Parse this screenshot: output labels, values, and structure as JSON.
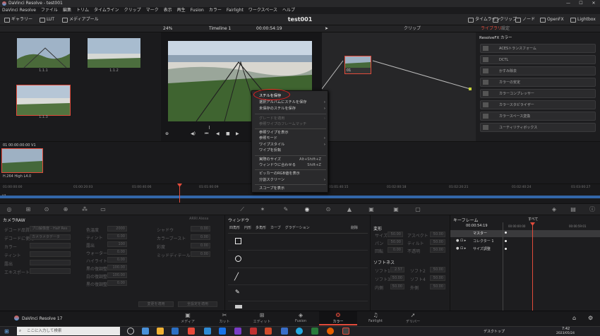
{
  "window": {
    "title": "DaVinci Resolve - test001",
    "min": "—",
    "max": "☐",
    "close": "✕"
  },
  "menu": [
    "DaVinci Resolve",
    "ファイル",
    "編集",
    "トリム",
    "タイムライン",
    "クリップ",
    "マーク",
    "表示",
    "再生",
    "Fusion",
    "カラー",
    "Fairlight",
    "ワークスペース",
    "ヘルプ"
  ],
  "toolbar": {
    "gallery": "ギャラリー",
    "lut": "LUT",
    "mediapool": "メディアプール",
    "project_title": "test001",
    "timeline": "タイムライン",
    "clip": "クリップ",
    "node": "ノード",
    "openfx": "OpenFX",
    "lightbox": "Lightbox"
  },
  "subtool": {
    "zoom": "24%",
    "timeline_name": "Timeline 1",
    "timecode": "00:00:54:19",
    "clip": "クリップ",
    "library": "ライブラリ",
    "settings": "設定"
  },
  "gallery": {
    "stills": [
      {
        "label": "1.1.1"
      },
      {
        "label": "1.1.2"
      },
      {
        "label": "1.1.3"
      }
    ]
  },
  "nodes": {
    "node_label": "01"
  },
  "library": {
    "title": "ResolveFX カラー",
    "items": [
      "ACESトランスフォーム",
      "DCTL",
      "かすみ除去",
      "カラーの安定",
      "カラーコンプレッサー",
      "カラースタビライザー",
      "カラースペース変換",
      "ユーティリティボックス"
    ]
  },
  "clips": {
    "header": "01  00:00:00:00  V1",
    "clip_name": "H.264 High L4.0"
  },
  "ruler": {
    "track": "V1",
    "ticks": [
      "01:00:00:00",
      "01:00:20:03",
      "01:00:40:06",
      "01:01:00:09",
      "01:01:20:12",
      "01:01:40:15",
      "01:02:00:18",
      "01:02:20:21",
      "01:02:40:24",
      "01:03:00:27"
    ]
  },
  "context_menu": {
    "items": [
      {
        "label": "スチルを保存",
        "shortcut": "",
        "arrow": false,
        "disabled": false
      },
      {
        "label": "選択アルバムにスチルを保存",
        "shortcut": "",
        "arrow": true,
        "disabled": false
      },
      {
        "label": "未保存のスチルを保存",
        "shortcut": "",
        "arrow": true,
        "disabled": false
      },
      {
        "label": "グレードを適用",
        "shortcut": "",
        "arrow": true,
        "disabled": true
      },
      {
        "label": "参照ワイプのフレームマッチ",
        "shortcut": "",
        "arrow": false,
        "disabled": true
      },
      {
        "label": "参照ワイプを表示",
        "shortcut": "",
        "arrow": false,
        "disabled": false
      },
      {
        "label": "参照モード",
        "shortcut": "",
        "arrow": true,
        "disabled": false
      },
      {
        "label": "ワイプスタイル",
        "shortcut": "",
        "arrow": true,
        "disabled": false
      },
      {
        "label": "ワイプを反転",
        "shortcut": "",
        "arrow": false,
        "disabled": false
      },
      {
        "label": "実際のサイズ",
        "shortcut": "Alt+Shift+Z",
        "arrow": false,
        "disabled": false
      },
      {
        "label": "ウィンドウに合わせる",
        "shortcut": "Shift+Z",
        "arrow": false,
        "disabled": false
      },
      {
        "label": "ピッカーのRGB値を表示",
        "shortcut": "",
        "arrow": false,
        "disabled": false
      },
      {
        "label": "分割スクリーン",
        "shortcut": "",
        "arrow": true,
        "disabled": false
      },
      {
        "label": "スコープを表示",
        "shortcut": "",
        "arrow": false,
        "disabled": false
      }
    ]
  },
  "camera_raw": {
    "title": "カメラRAW",
    "format": "ARRI Alexa",
    "left_labels": [
      "デコード品質",
      "デコードに使用",
      "カラー",
      "ティント",
      "露出",
      "エキスポート"
    ],
    "left_values": [
      "プロ解像度 - Half Res",
      "カメラメタデータ",
      "",
      "",
      "",
      ""
    ],
    "mid_labels": [
      "色温度",
      "ティント",
      "露出",
      "ウォーターマス",
      "ハイライト",
      "黒の復調整",
      "白の復調整",
      "黒の復調整"
    ],
    "mid_values": [
      "2000",
      "0.00",
      "100",
      "0.00",
      "0.00",
      "100.00",
      "100.00",
      "0.00"
    ],
    "right_labels": [
      "シャドウ",
      "カラーブースト",
      "彩度",
      "ミッドディテール"
    ],
    "right_values": [
      "0.00",
      "0.00",
      "0.00",
      "0.00"
    ],
    "apply_btn": "変更を適用",
    "reset_btn": "全設定を適用"
  },
  "window_panel": {
    "title": "ウィンドウ",
    "tools": [
      "四角形",
      "円形",
      "多角形",
      "カーブ",
      "グラデーション"
    ],
    "delete": "削除"
  },
  "transform": {
    "title": "変形",
    "rows": [
      [
        "サイズ",
        "50.00",
        "アスペクト",
        "50.00"
      ],
      [
        "パン",
        "50.00",
        "ティルト",
        "50.00"
      ],
      [
        "回転",
        "0.00",
        "不透明",
        "50.00"
      ]
    ],
    "softness_title": "ソフトネス",
    "soft_rows": [
      [
        "ソフト1",
        "2.57",
        "ソフト2",
        "50.00"
      ],
      [
        "ソフト3",
        "50.00",
        "ソフト4",
        "50.00"
      ],
      [
        "内側",
        "50.00",
        "外側",
        "50.00"
      ]
    ]
  },
  "keyframes": {
    "title": "キーフレーム",
    "filter": "すべて",
    "timecode": "00:00:54:19",
    "start": "00:00:00:00",
    "end": "00:00:59:01",
    "rows": [
      "マスター",
      "コレクター 1",
      "サイズ調整"
    ]
  },
  "pages": [
    {
      "icon": "▣",
      "label": "メディア"
    },
    {
      "icon": "✂",
      "label": "カット"
    },
    {
      "icon": "⊞",
      "label": "エディット"
    },
    {
      "icon": "◈",
      "label": "Fusion"
    },
    {
      "icon": "❂",
      "label": "カラー"
    },
    {
      "icon": "♫",
      "label": "Fairlight"
    },
    {
      "icon": "➚",
      "label": "デリバー"
    }
  ],
  "app_name": "DaVinci Resolve 17",
  "taskbar": {
    "search": "ここに入力して検索",
    "desktop": "デスクトップ",
    "time": "7:42",
    "date": "2023/05/24"
  },
  "colors": {
    "accent": "#e24b3b",
    "track_blue": "#3366a8",
    "bg": "#1f1f21"
  }
}
